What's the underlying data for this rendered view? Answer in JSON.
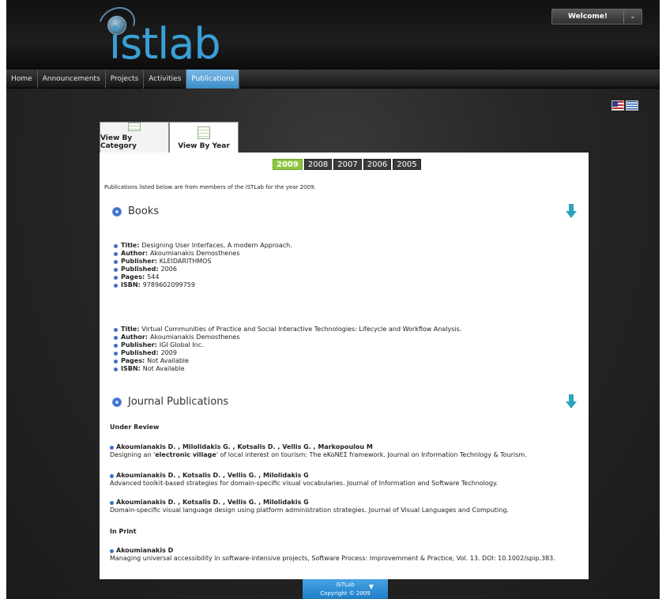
{
  "header": {
    "logo_text": "istlab",
    "welcome_label": "Welcome!",
    "welcome_arrow": "⌄"
  },
  "nav": {
    "items": [
      {
        "label": "Home"
      },
      {
        "label": "Announcements"
      },
      {
        "label": "Projects"
      },
      {
        "label": "Activities"
      },
      {
        "label": "Publications"
      }
    ],
    "active": "Publications"
  },
  "tabs": [
    {
      "label": "View By Category"
    },
    {
      "label": "View By Year"
    }
  ],
  "years": [
    "2009",
    "2008",
    "2007",
    "2006",
    "2005"
  ],
  "selected_year": "2009",
  "intro": "Publications listed below are from members of the iSTLab for the year 2009.",
  "books": {
    "title": "Books",
    "items": [
      {
        "title_k": "Title:",
        "title_v": "Designing User Interfaces, A modern Approach.",
        "author_k": "Author:",
        "author_v": "Akoumianakis Demosthenes",
        "publisher_k": "Publisher:",
        "publisher_v": "KLEIDARITHMOS",
        "published_k": "Published:",
        "published_v": "2006",
        "pages_k": "Pages:",
        "pages_v": "544",
        "isbn_k": "ISBN:",
        "isbn_v": "9789602099759"
      },
      {
        "title_k": "Title:",
        "title_v": "Virtual Communities of Practice and Social Interactive Technologies: Lifecycle and Workflow Analysis.",
        "author_k": "Author:",
        "author_v": "Akoumianakis Demosthenes",
        "publisher_k": "Publisher:",
        "publisher_v": "IGI Global Inc.",
        "published_k": "Published:",
        "published_v": "2009",
        "pages_k": "Pages:",
        "pages_v": "Not Available",
        "isbn_k": "ISBN:",
        "isbn_v": "Not Available"
      }
    ]
  },
  "journal": {
    "title": "Journal Publications",
    "under_review_label": "Under Review",
    "in_print_label": "In Print",
    "pubs": [
      {
        "authors": "Akoumianakis D. , Milolidakis G. , Kotsalis D. , Vellis G. , Markopoulou M",
        "desc_a": "Designing an '",
        "desc_b": "electronic village",
        "desc_c": "' of local interest on tourism: The eKoNEΣ framework. Journal on Information Technlogy & Tourism."
      },
      {
        "authors": "Akoumianakis D. , Kotsalis D. , Vellis G. , Milolidakis G",
        "desc": "Advanced toolkit-based strategies for domain-specific visual vocabularies. Journal of Information and Software Technology."
      },
      {
        "authors": "Akoumianakis D. , Kotsalis D. , Vellis G. , Milolidakis G",
        "desc": "Domain-specific visual language design using platform administration strategies. Journal of Visual Languages and Computing."
      },
      {
        "authors": "Akoumianakis D",
        "desc": "Managing universal accessibility in software-intensive projects, Software Process: Improvemment & Practice, Vol. 13. DOI: 10.1002/spip.383."
      }
    ]
  },
  "footer": {
    "line1": "iSTLab",
    "line2": "Copyright © 2009",
    "arrow": "▼"
  },
  "colors": {
    "accent": "#3aa0d6",
    "active_year": "#8cc63e",
    "nav_active": "#4d9bd6"
  }
}
